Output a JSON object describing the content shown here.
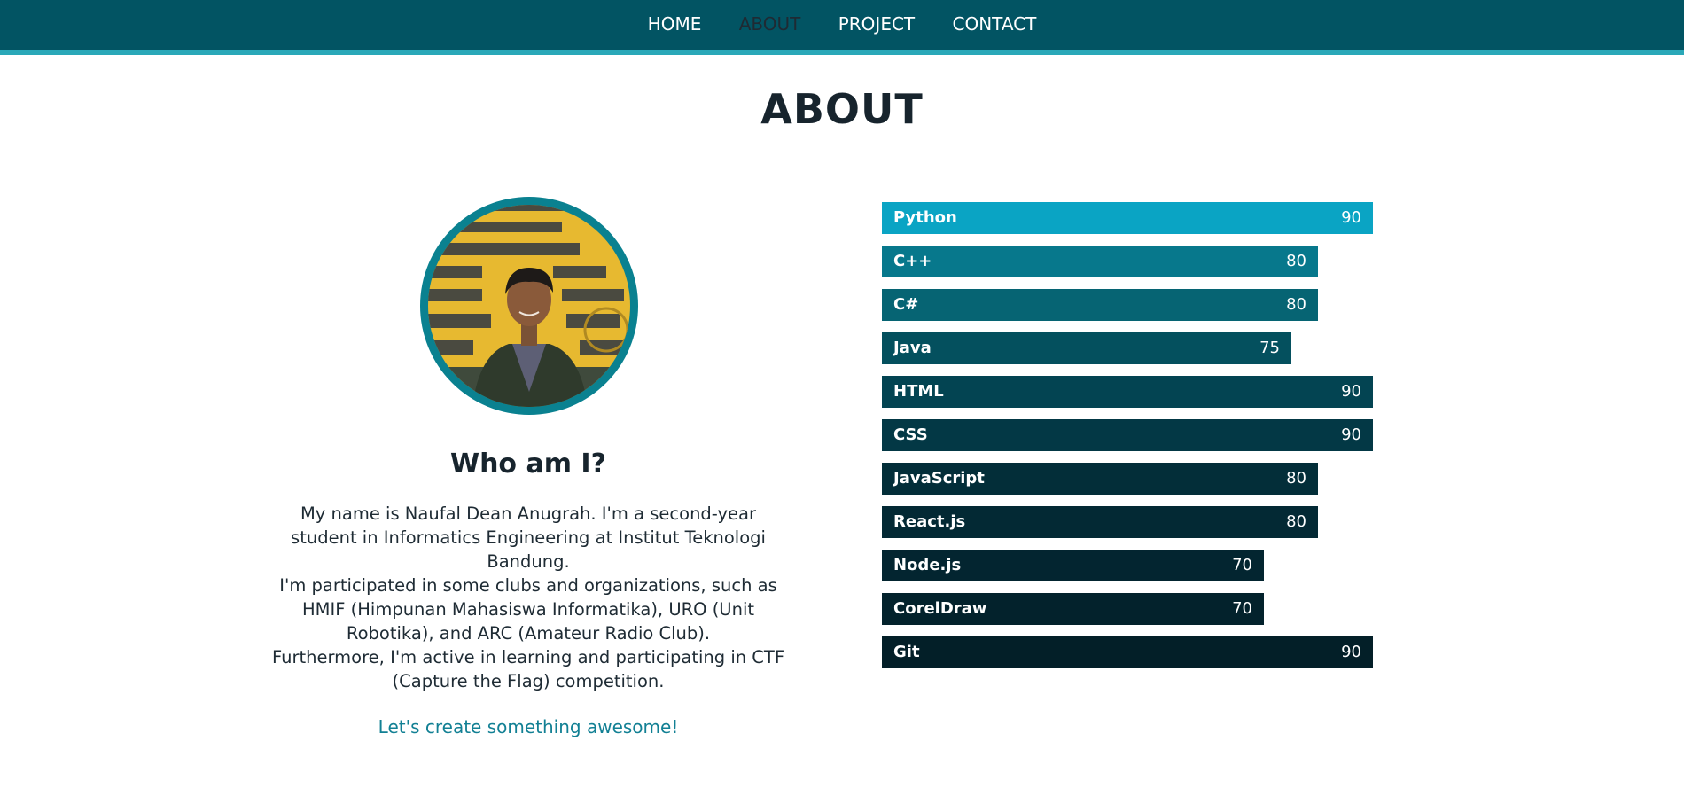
{
  "nav": {
    "items": [
      {
        "label": "HOME"
      },
      {
        "label": "ABOUT",
        "active": true
      },
      {
        "label": "PROJECT"
      },
      {
        "label": "CONTACT"
      }
    ]
  },
  "page": {
    "title": "ABOUT"
  },
  "about": {
    "heading": "Who am I?",
    "bio_1": "My name is Naufal Dean Anugrah. I'm a second-year student in Informatics Engineering at Institut Teknologi Bandung.",
    "bio_2": "I'm participated in some clubs and organizations, such as HMIF (Himpunan Mahasiswa Informatika), URO (Unit Robotika), and ARC (Amateur Radio Club).",
    "bio_3": "Furthermore, I'm active in learning and participating in CTF (Capture the Flag) competition.",
    "cta": "Let's create something awesome!"
  },
  "skills": {
    "max": 90,
    "items": [
      {
        "name": "Python",
        "value": 90,
        "color": "#0aa4c4"
      },
      {
        "name": "C++",
        "value": 80,
        "color": "#07788c"
      },
      {
        "name": "C#",
        "value": 80,
        "color": "#066473"
      },
      {
        "name": "Java",
        "value": 75,
        "color": "#04505e"
      },
      {
        "name": "HTML",
        "value": 90,
        "color": "#034452"
      },
      {
        "name": "CSS",
        "value": 90,
        "color": "#033845"
      },
      {
        "name": "JavaScript",
        "value": 80,
        "color": "#032e39"
      },
      {
        "name": "React.js",
        "value": 80,
        "color": "#032934"
      },
      {
        "name": "Node.js",
        "value": 70,
        "color": "#032530"
      },
      {
        "name": "CorelDraw",
        "value": 70,
        "color": "#03222c"
      },
      {
        "name": "Git",
        "value": 90,
        "color": "#031f28"
      }
    ]
  },
  "colors": {
    "navbar": "#025463",
    "nav_accent": "#2aa8b8",
    "link": "#128094"
  }
}
